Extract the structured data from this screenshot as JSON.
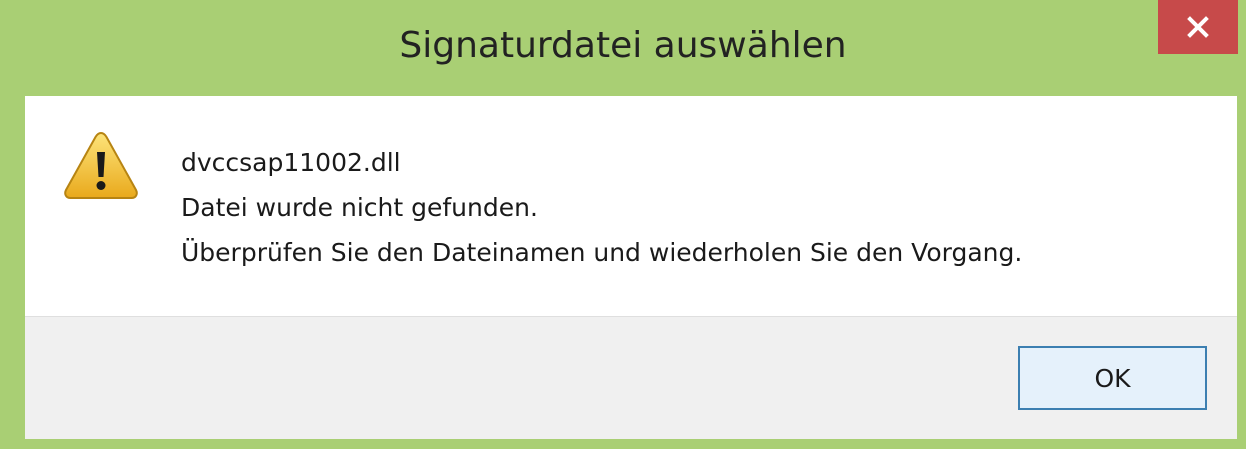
{
  "window": {
    "title": "Signaturdatei auswählen",
    "close_icon": "close-icon",
    "accent_color": "#a9cf74",
    "close_color": "#c74a4a"
  },
  "message": {
    "icon": "warning-icon",
    "lines": [
      "dvccsap11002.dll",
      "Datei wurde nicht gefunden.",
      "Überprüfen Sie den Dateinamen und wiederholen Sie den Vorgang."
    ]
  },
  "footer": {
    "ok_label": "OK"
  }
}
